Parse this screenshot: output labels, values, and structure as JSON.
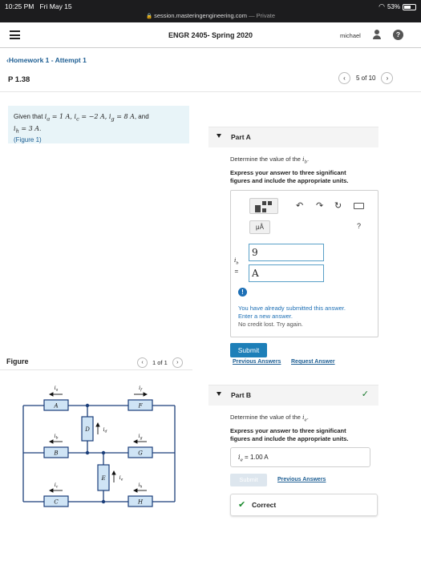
{
  "status": {
    "time": "10:25 PM",
    "date": "Fri May 15",
    "url": "session.masteringengineering.com",
    "private": "— Private",
    "battery": "53%"
  },
  "header": {
    "course": "ENGR 2405- Spring 2020",
    "user": "michael"
  },
  "nav": {
    "breadcrumb": "Homework 1 - Attempt 1",
    "problem": "P 1.38",
    "pager": "5 of 10"
  },
  "given": {
    "p1": "Given that",
    "ia": "i",
    "ia_sub": "a",
    "ia_val": " = 1 A, ",
    "ic": "i",
    "ic_sub": "c",
    "ic_val": " = −2 A, ",
    "ig": "i",
    "ig_sub": "g",
    "ig_val": " = 8 A",
    "and": ", and",
    "ih": "i",
    "ih_sub": "h",
    "ih_val": " = 3 A",
    "end": ".",
    "figure_link": "(Figure 1)"
  },
  "figure": {
    "label": "Figure",
    "pager": "1 of 1",
    "boxes": [
      "A",
      "F",
      "D",
      "B",
      "G",
      "E",
      "C",
      "H"
    ],
    "currents": {
      "a": "i_a",
      "f": "i_f",
      "b": "i_b",
      "d": "i_d",
      "g": "i_g",
      "e": "i_e",
      "c": "i_c",
      "h": "i_h"
    }
  },
  "partA": {
    "title": "Part A",
    "prompt_pre": "Determine the value of the ",
    "var": "i",
    "var_sub": "b",
    "prompt_post": ".",
    "instructions_1": "Express your answer to three significant",
    "instructions_2": "figures and include the appropriate units.",
    "mu_label": "μÅ",
    "help": "?",
    "var_label": "i_b",
    "eq": "=",
    "value": "9",
    "units": "A",
    "warning_1": "You have already submitted this answer.",
    "warning_2": "Enter a new answer.",
    "warning_3": "No credit lost. Try again.",
    "submit": "Submit",
    "prev_answers": "Previous Answers",
    "request_answer": "Request Answer"
  },
  "partB": {
    "title": "Part B",
    "prompt_pre": "Determine the value of the ",
    "var": "i",
    "var_sub": "e",
    "prompt_post": ".",
    "instructions_1": "Express your answer to three significant",
    "instructions_2": "figures and include the appropriate units.",
    "answer_var": "i",
    "answer_sub": "e",
    "answer_val": " = 1.00 A",
    "submit": "Submit",
    "prev_answers": "Previous Answers",
    "result": "Correct"
  },
  "colors": {
    "link": "#1d5e93",
    "submit": "#1d7fb8",
    "given_bg": "#e8f4f8",
    "circuit": "#1b3e7a",
    "box_fill": "#cfe4f5",
    "correct": "#1a8a2e"
  }
}
